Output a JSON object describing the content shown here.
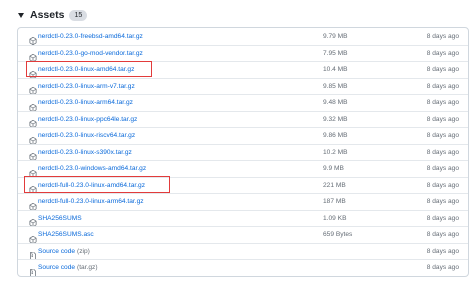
{
  "header": {
    "title": "Assets",
    "count": "15"
  },
  "assets": [
    {
      "name": "nerdctl-0.23.0-freebsd-amd64.tar.gz",
      "size": "9.79 MB",
      "date": "8 days ago"
    },
    {
      "name": "nerdctl-0.23.0-go-mod-vendor.tar.gz",
      "size": "7.95 MB",
      "date": "8 days ago"
    },
    {
      "name": "nerdctl-0.23.0-linux-amd64.tar.gz",
      "size": "10.4 MB",
      "date": "8 days ago"
    },
    {
      "name": "nerdctl-0.23.0-linux-arm-v7.tar.gz",
      "size": "9.85 MB",
      "date": "8 days ago"
    },
    {
      "name": "nerdctl-0.23.0-linux-arm64.tar.gz",
      "size": "9.48 MB",
      "date": "8 days ago"
    },
    {
      "name": "nerdctl-0.23.0-linux-ppc64le.tar.gz",
      "size": "9.32 MB",
      "date": "8 days ago"
    },
    {
      "name": "nerdctl-0.23.0-linux-riscv64.tar.gz",
      "size": "9.86 MB",
      "date": "8 days ago"
    },
    {
      "name": "nerdctl-0.23.0-linux-s390x.tar.gz",
      "size": "10.2 MB",
      "date": "8 days ago"
    },
    {
      "name": "nerdctl-0.23.0-windows-amd64.tar.gz",
      "size": "9.9 MB",
      "date": "8 days ago"
    },
    {
      "name": "nerdctl-full-0.23.0-linux-amd64.tar.gz",
      "size": "221 MB",
      "date": "8 days ago"
    },
    {
      "name": "nerdctl-full-0.23.0-linux-arm64.tar.gz",
      "size": "187 MB",
      "date": "8 days ago"
    },
    {
      "name": "SHA256SUMS",
      "size": "1.09 KB",
      "date": "8 days ago"
    },
    {
      "name": "SHA256SUMS.asc",
      "size": "659 Bytes",
      "date": "8 days ago"
    },
    {
      "name": "Source code",
      "paren": "(zip)",
      "size": "",
      "date": "8 days ago"
    },
    {
      "name": "Source code",
      "paren": "(tar.gz)",
      "size": "",
      "date": "8 days ago"
    }
  ],
  "highlighted_assets": [
    "nerdctl-0.23.0-linux-amd64.tar.gz",
    "nerdctl-full-0.23.0-linux-amd64.tar.gz"
  ],
  "colors": {
    "link": "#0969da",
    "muted": "#656d76",
    "border": "#d0d7de",
    "highlight": "#e23b3b"
  },
  "icons": {
    "package": "package-icon",
    "file_zip": "file-zip-icon",
    "caret": "triangle-down-icon"
  }
}
